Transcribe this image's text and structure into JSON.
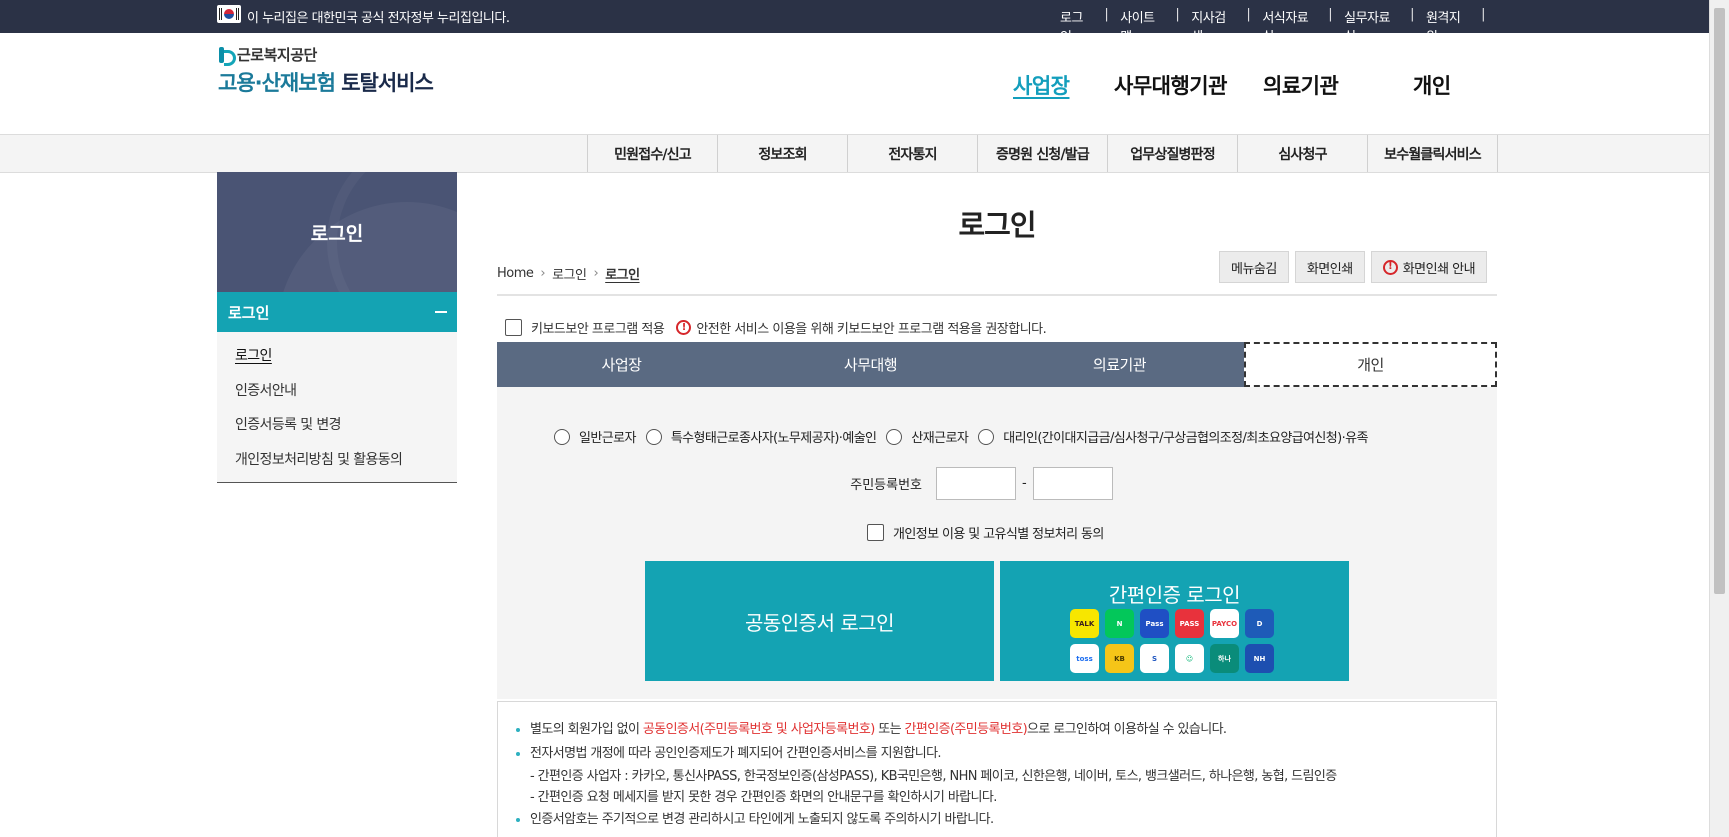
{
  "gov_bar": {
    "notice": "이 누리집은 대한민국 공식 전자정부 누리집입니다.",
    "links": [
      "로그인",
      "사이트맵",
      "지사검색",
      "서식자료실",
      "실무자료실",
      "원격지원"
    ]
  },
  "logo": {
    "org": "근로복지공단",
    "service_blue": "고용·산재보험",
    "service_dark": "토탈서비스"
  },
  "main_nav": [
    "사업장",
    "사무대행기관",
    "의료기관",
    "개인"
  ],
  "sub_nav": [
    "민원접수/신고",
    "정보조회",
    "전자통지",
    "증명원 신청/발급",
    "업무상질병판정",
    "심사청구",
    "보수월클릭서비스"
  ],
  "sidebar": {
    "title": "로그인",
    "active_group": "로그인",
    "items": [
      "로그인",
      "인증서안내",
      "인증서등록 및 변경",
      "개인정보처리방침 및 활용동의"
    ]
  },
  "page": {
    "title": "로그인",
    "breadcrumb": [
      "Home",
      "로그인",
      "로그인"
    ],
    "buttons": [
      "메뉴숨김",
      "화면인쇄",
      "화면인쇄 안내"
    ]
  },
  "keyboard_security": {
    "label": "키보드보안 프로그램 적용",
    "notice": "안전한 서비스 이용을 위해 키보드보안 프로그램 적용을 권장합니다."
  },
  "tabs": [
    "사업장",
    "사무대행",
    "의료기관",
    "개인"
  ],
  "selected_tab": "개인",
  "login_form": {
    "radios": [
      "일반근로자",
      "특수형태근로종사자(노무제공자)·예술인",
      "산재근로자",
      "대리인(간이대지급금/심사청구/구상금협의조정/최초요양급여신청)·유족"
    ],
    "rrn_label": "주민등록번호",
    "rrn_first": "",
    "rrn_second": "",
    "rrn_sep": "-",
    "consent_label": "개인정보 이용 및 고유식별 정보처리 동의",
    "cert_button": "공동인증서 로그인",
    "easy_button": "간편인증 로그인"
  },
  "easy_auth_icons": [
    {
      "name": "kakao-talk-icon",
      "text": "TALK",
      "bg": "#f7e600",
      "fg": "#3a1d1d"
    },
    {
      "name": "naver-icon",
      "text": "N",
      "bg": "#03c75a",
      "fg": "#ffffff"
    },
    {
      "name": "samsung-pass-icon",
      "text": "Pass",
      "bg": "#1f4fc4",
      "fg": "#ffffff"
    },
    {
      "name": "pass-icon",
      "text": "PASS",
      "bg": "#e8323c",
      "fg": "#ffffff"
    },
    {
      "name": "payco-icon",
      "text": "PAYCO",
      "bg": "#ffffff",
      "fg": "#e8323c"
    },
    {
      "name": "dream-auth-icon",
      "text": "D",
      "bg": "#1e5bb8",
      "fg": "#ffffff"
    },
    {
      "name": "toss-icon",
      "text": "toss",
      "bg": "#ffffff",
      "fg": "#1e6ff0"
    },
    {
      "name": "kb-icon",
      "text": "KB",
      "bg": "#f5c518",
      "fg": "#4a3a00"
    },
    {
      "name": "shinhan-icon",
      "text": "S",
      "bg": "#ffffff",
      "fg": "#1f56c0"
    },
    {
      "name": "banksalad-icon",
      "text": "☺",
      "bg": "#ffffff",
      "fg": "#11b87a"
    },
    {
      "name": "hana-bank-icon",
      "text": "하나",
      "bg": "#0a8c7a",
      "fg": "#ffffff"
    },
    {
      "name": "nh-icon",
      "text": "NH",
      "bg": "#1d4fb0",
      "fg": "#ffffff"
    }
  ],
  "info": {
    "line1_a": "별도의 회원가입 없이 ",
    "line1_red1": "공동인증서(주민등록번호 및 사업자등록번호)",
    "line1_b": " 또는 ",
    "line1_red2": "간편인증(주민등록번호)",
    "line1_c": "으로 로그인하여 이용하실 수 있습니다.",
    "line2": "전자서명법 개정에 따라 공인인증제도가 폐지되어 간편인증서비스를 지원합니다.",
    "line2_sub1": "- 간편인증 사업자 : 카카오, 통신사PASS, 한국정보인증(삼성PASS), KB국민은행, NHN 페이코, 신한은행, 네이버, 토스, 뱅크샐러드, 하나은행, 농협, 드림인증",
    "line2_sub2": "- 간편인증 요청 메세지를 받지 못한 경우 간편인증 화면의 안내문구를 확인하시기 바랍니다.",
    "line3": "인증서암호는 주기적으로 변경 관리하시고 타인에게 노출되지 않도록 주의하시기 바랍니다."
  }
}
